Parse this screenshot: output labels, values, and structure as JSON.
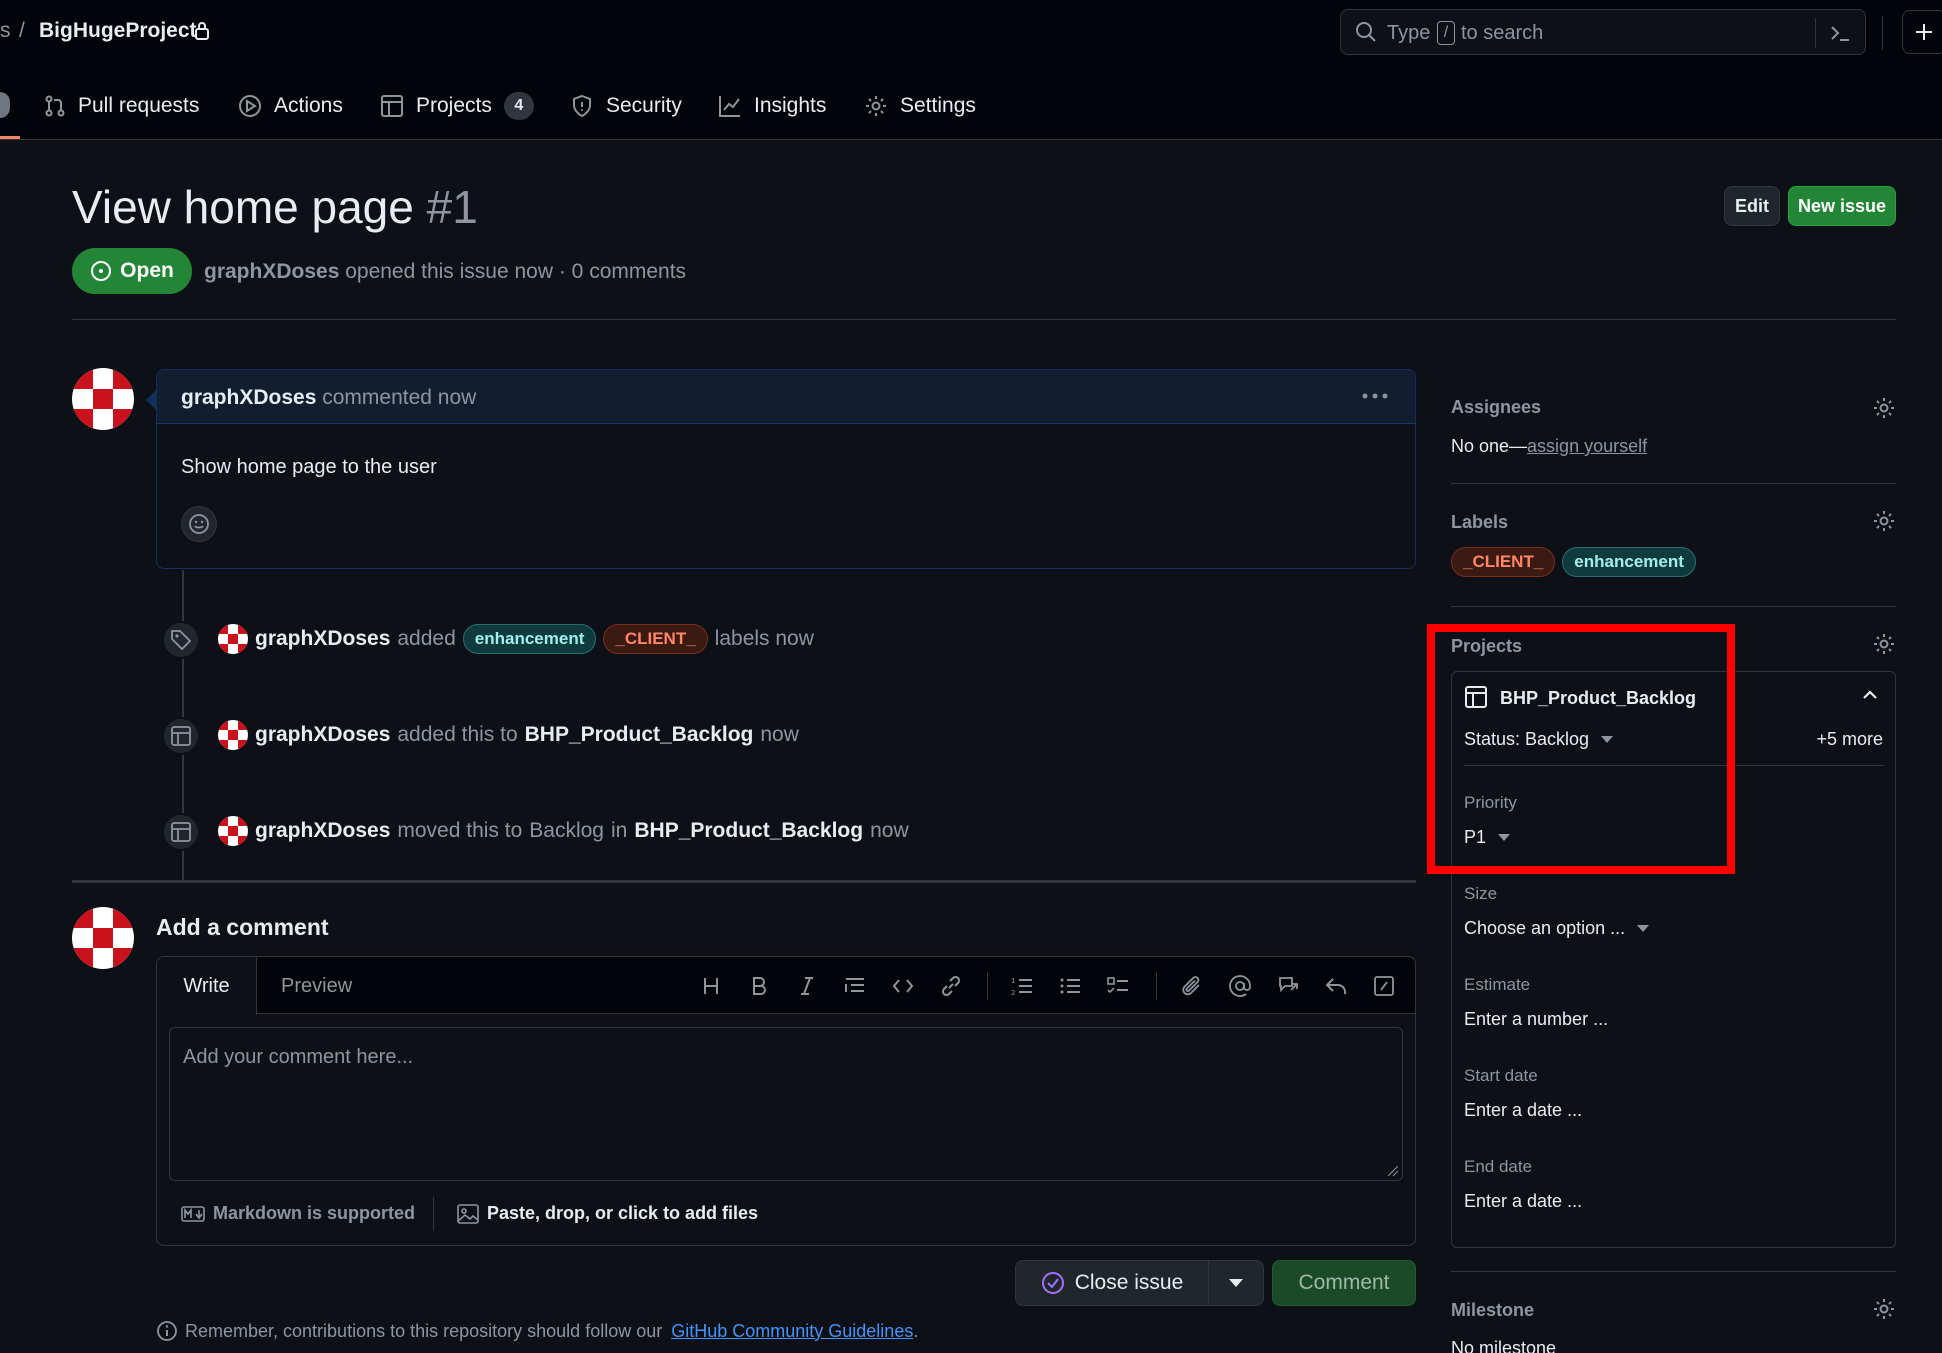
{
  "header": {
    "breadcrumb_prefix": "s",
    "breadcrumb_sep": "/",
    "repo_name": "BigHugeProject",
    "search_placeholder_pre": "Type",
    "search_key": "/",
    "search_placeholder_post": "to search"
  },
  "nav": {
    "pull_requests": "Pull requests",
    "actions": "Actions",
    "projects": "Projects",
    "projects_count": "4",
    "security": "Security",
    "insights": "Insights",
    "settings": "Settings"
  },
  "issue": {
    "title": "View home page",
    "number": "#1",
    "state": "Open",
    "author": "graphXDoses",
    "meta": "opened this issue now · 0 comments",
    "edit_label": "Edit",
    "new_issue_label": "New issue"
  },
  "comment": {
    "author": "graphXDoses",
    "action": "commented now",
    "body": "Show home page to the user"
  },
  "timeline": [
    {
      "actor": "graphXDoses",
      "pre": "added",
      "labels": [
        "enhancement",
        "_CLIENT_"
      ],
      "post": "labels now"
    },
    {
      "actor": "graphXDoses",
      "pre": "added this to",
      "project": "BHP_Product_Backlog",
      "post": "now"
    },
    {
      "actor": "graphXDoses",
      "pre": "moved this to",
      "column": "Backlog",
      "mid": "in",
      "project": "BHP_Product_Backlog",
      "post": "now"
    }
  ],
  "composer": {
    "heading": "Add a comment",
    "tab_write": "Write",
    "tab_preview": "Preview",
    "placeholder": "Add your comment here...",
    "markdown_note": "Markdown is supported",
    "files_note": "Paste, drop, or click to add files",
    "close_issue": "Close issue",
    "comment_button": "Comment",
    "footer_pre": "Remember, contributions to this repository should follow our",
    "footer_link": "GitHub Community Guidelines",
    "footer_post": "."
  },
  "sidebar": {
    "assignees_heading": "Assignees",
    "assignees_value": "No one—",
    "assign_yourself": "assign yourself",
    "labels_heading": "Labels",
    "labels": [
      "_CLIENT_",
      "enhancement"
    ],
    "projects_heading": "Projects",
    "project_name": "BHP_Product_Backlog",
    "status": "Status: Backlog",
    "more": "+5 more",
    "priority_key": "Priority",
    "priority_value": "P1",
    "size_key": "Size",
    "size_value": "Choose an option ...",
    "estimate_key": "Estimate",
    "estimate_value": "Enter a number ...",
    "start_key": "Start date",
    "start_value": "Enter a date ...",
    "end_key": "End date",
    "end_value": "Enter a date ...",
    "milestone_heading": "Milestone",
    "milestone_value": "No milestone"
  },
  "colors": {
    "open_green": "#238636",
    "highlight_red": "#ff0000",
    "link_blue": "#4493f8"
  }
}
